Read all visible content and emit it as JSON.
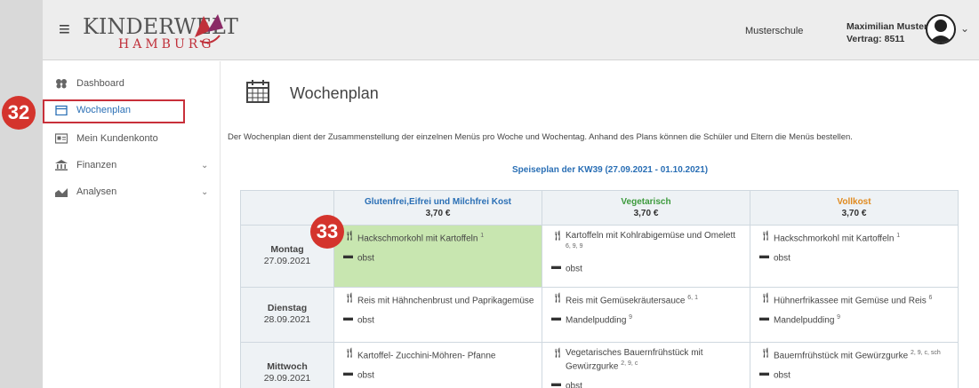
{
  "header": {
    "logo_main": "KINDERWELT",
    "logo_sub": "HAMBURG",
    "school": "Musterschule",
    "user_name": "Maximilian Muster",
    "contract": "Vertrag: 8511",
    "menu_icon": "hamburger-icon",
    "dropdown_icon": "chevron-down-icon"
  },
  "sidebar": {
    "items": [
      {
        "label": "Dashboard",
        "icon": "dashboard-icon"
      },
      {
        "label": "Wochenplan",
        "icon": "calendar-icon"
      },
      {
        "label": "Mein Kundenkonto",
        "icon": "id-card-icon"
      },
      {
        "label": "Finanzen",
        "icon": "bank-icon"
      },
      {
        "label": "Analysen",
        "icon": "chart-icon"
      }
    ]
  },
  "annotations": {
    "badge_a": "32",
    "badge_b": "33",
    "color": "#d4342d"
  },
  "main": {
    "title": "Wochenplan",
    "intro": "Der Wochenplan dient der Zusammenstellung der einzelnen Menüs pro Woche und Wochentag. Anhand des Plans können die Schüler und Eltern die Menüs bestellen.",
    "plan_title": "Speiseplan der KW39 (27.09.2021 - 01.10.2021)"
  },
  "columns": [
    {
      "name": "Glutenfrei,Eifrei und Milchfrei Kost",
      "price": "3,70 €",
      "color": "#2a6fb5"
    },
    {
      "name": "Vegetarisch",
      "price": "3,70 €",
      "color": "#3c9a3c"
    },
    {
      "name": "Vollkost",
      "price": "3,70 €",
      "color": "#e08a1e"
    }
  ],
  "days": [
    {
      "name": "Montag",
      "date": "27.09.2021",
      "meals": [
        {
          "main": "Hackschmorkohl mit Kartoffeln",
          "main_sup": "1",
          "dessert": "obst",
          "dessert_sup": ""
        },
        {
          "main": "Kartoffeln mit Kohlrabigemüse und Omelett",
          "main_sup": "6, 9, 9",
          "dessert": "obst",
          "dessert_sup": ""
        },
        {
          "main": "Hackschmorkohl mit Kartoffeln",
          "main_sup": "1",
          "dessert": "obst",
          "dessert_sup": ""
        }
      ]
    },
    {
      "name": "Dienstag",
      "date": "28.09.2021",
      "meals": [
        {
          "main": "Reis mit Hähnchenbrust und Paprikagemüse",
          "main_sup": "",
          "dessert": "obst",
          "dessert_sup": ""
        },
        {
          "main": "Reis mit Gemüsekräutersauce",
          "main_sup": "6, 1",
          "dessert": "Mandelpudding",
          "dessert_sup": "9"
        },
        {
          "main": "Hühnerfrikassee mit Gemüse und Reis",
          "main_sup": "6",
          "dessert": "Mandelpudding",
          "dessert_sup": "9"
        }
      ]
    },
    {
      "name": "Mittwoch",
      "date": "29.09.2021",
      "meals": [
        {
          "main": "Kartoffel- Zucchini-Möhren- Pfanne",
          "main_sup": "",
          "dessert": "obst",
          "dessert_sup": ""
        },
        {
          "main": "Vegetarisches Bauernfrühstück mit Gewürzgurke",
          "main_sup": "2, 9, c",
          "dessert": "obst",
          "dessert_sup": ""
        },
        {
          "main": "Bauernfrühstück mit Gewürzgurke",
          "main_sup": "2, 9, c, sch",
          "dessert": "obst",
          "dessert_sup": ""
        }
      ]
    }
  ]
}
